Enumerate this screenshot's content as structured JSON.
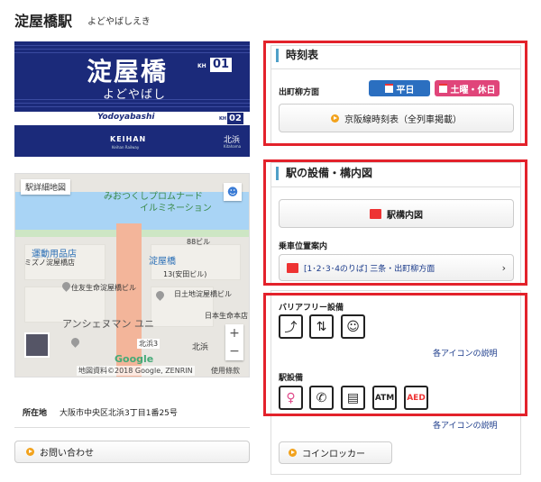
{
  "header": {
    "title": "淀屋橋駅",
    "kana": "よどやばしえき"
  },
  "sign": {
    "name": "淀屋橋",
    "code_prefix": "KH",
    "code_num": "01",
    "kana": "よどやばし",
    "next_roman": "Yodoyabashi",
    "next_code_prefix": "KH",
    "next_code_num": "02",
    "logo": "KEIHAN",
    "logo_sub": "Keihan Railway",
    "next_station_kanji": "北浜",
    "next_station_roman": "Kitahama"
  },
  "map": {
    "detail_link": "駅詳細地図",
    "labels": [
      "みおつくしプロムナード",
      "イルミネーション",
      "運動用品店",
      "ミズノ淀屋橋店",
      "淀屋橋",
      "住友生命淀屋橋ビル",
      "日土地淀屋橋ビル",
      "日本生命本店",
      "アンシェヌマン ユニ",
      "北浜3",
      "北浜",
      "13(安田ビル)",
      "88ビル"
    ],
    "google": "Google",
    "attribution": "地図資料©2018 Google, ZENRIN",
    "terms": "使用條款",
    "zoom_in": "+",
    "zoom_out": "−"
  },
  "address": {
    "label": "所在地",
    "value": "大阪市中央区北浜3丁目1番25号"
  },
  "contact": {
    "label": "お問い合わせ"
  },
  "timetable": {
    "heading": "時刻表",
    "direction": "出町柳方面",
    "weekday": "平日",
    "holiday": "土曜・休日",
    "full_button": "京阪線時刻表（全列車掲載）"
  },
  "facilities": {
    "heading": "駅の設備・構内図",
    "map_button": "駅構内図",
    "boarding_label": "乗車位置案内",
    "boarding_button": "[1･2･3･4のりば] 三条・出町柳方面"
  },
  "barrier_free": {
    "label": "バリアフリー設備",
    "icons": [
      "escalator-icon",
      "elevator-icon",
      "baby-care-icon"
    ],
    "icon_link": "各アイコンの説明"
  },
  "station_equipment": {
    "label": "駅設備",
    "icons": [
      "restroom-icon",
      "phone-icon",
      "locker-icon",
      "atm-icon",
      "aed-icon"
    ],
    "icon_texts": {
      "atm": "ATM",
      "aed": "AED"
    },
    "icon_link": "各アイコンの説明",
    "locker_button": "コインロッカー"
  },
  "colors": {
    "sign_bg": "#1b2a7a",
    "highlight": "#e3222b",
    "weekday": "#2b6fc0",
    "holiday": "#e0457a",
    "accent": "#f2a21c"
  }
}
